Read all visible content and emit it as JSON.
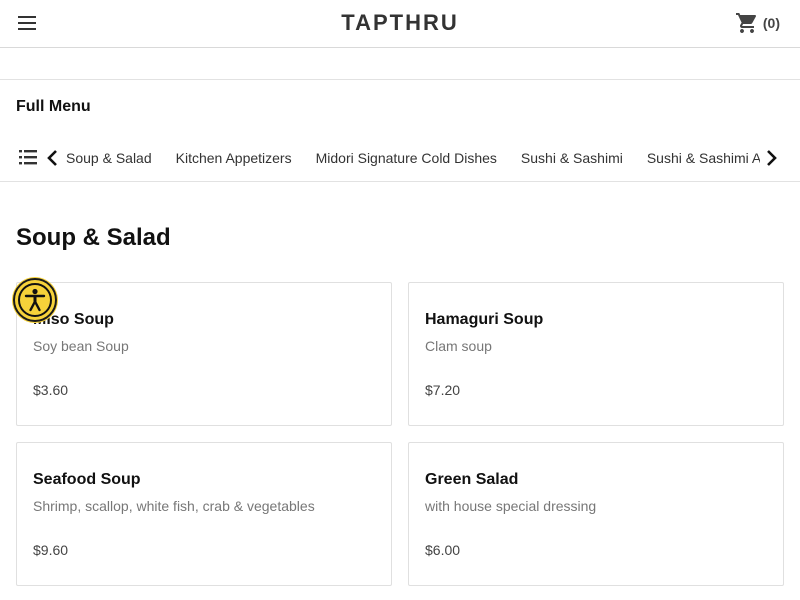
{
  "header": {
    "brand": "TAPTHRU",
    "cart_count": "(0)",
    "menu_icon": "hamburger-icon",
    "cart_icon": "shopping-cart-icon"
  },
  "menu": {
    "title": "Full Menu",
    "categories": [
      {
        "label": "Soup & Salad"
      },
      {
        "label": "Kitchen Appetizers"
      },
      {
        "label": "Midori Signature Cold Dishes"
      },
      {
        "label": "Sushi & Sashimi"
      },
      {
        "label": "Sushi & Sashimi A la Carte"
      }
    ]
  },
  "section": {
    "title": "Soup & Salad",
    "items": [
      {
        "name": "Miso Soup",
        "description": "Soy bean Soup",
        "price": "$3.60"
      },
      {
        "name": "Hamaguri Soup",
        "description": "Clam soup",
        "price": "$7.20"
      },
      {
        "name": "Seafood Soup",
        "description": "Shrimp, scallop, white fish, crab & vegetables",
        "price": "$9.60"
      },
      {
        "name": "Green Salad",
        "description": "with house special dressing",
        "price": "$6.00"
      }
    ]
  },
  "colors": {
    "accessibility_badge": "#f6d23a",
    "border": "#e0e0e0",
    "muted_text": "#777777"
  }
}
